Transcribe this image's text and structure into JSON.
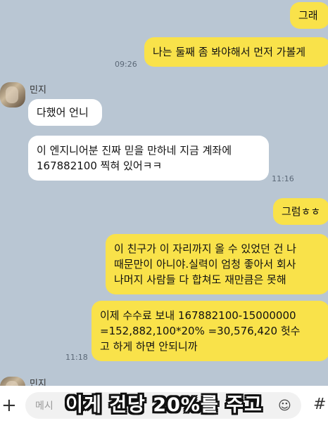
{
  "messages": {
    "m1": "그래",
    "m2": "나는 둘째 좀 봐야해서 먼저 가볼게",
    "t1": "09:26",
    "sender": "민지",
    "m3": "다했어 언니",
    "m4_line1": "이 엔지니어분 진짜 믿을 만하네 지금 계좌에",
    "m4_line2": "167882100 찍혀 있어ㅋㅋ",
    "t2": "11:16",
    "m5": "그럼ㅎㅎ",
    "m6_line1": "이 친구가 이 자리까지 올 수 있었던 건 나",
    "m6_line2": "때문만이 아니야.실력이 엄청 좋아서 회사",
    "m6_line3": "나머지 사람들 다 합쳐도 재만큼은 못해",
    "m7_line1": "이제 수수료 보내 167882100-15000000",
    "m7_line2": "=152,882,100*20% =30,576,420 헛수",
    "m7_line3": "고 하게 하면 안되니까",
    "t3": "11:18",
    "sender2": "민지"
  },
  "input": {
    "placeholder": "메시",
    "plus": "+",
    "emoji": "☺",
    "hash": "#"
  },
  "caption": "이게 건당 20%를 주고",
  "colors": {
    "background": "#b9c6d3",
    "my_bubble": "#f9e24a",
    "their_bubble": "#ffffff"
  }
}
